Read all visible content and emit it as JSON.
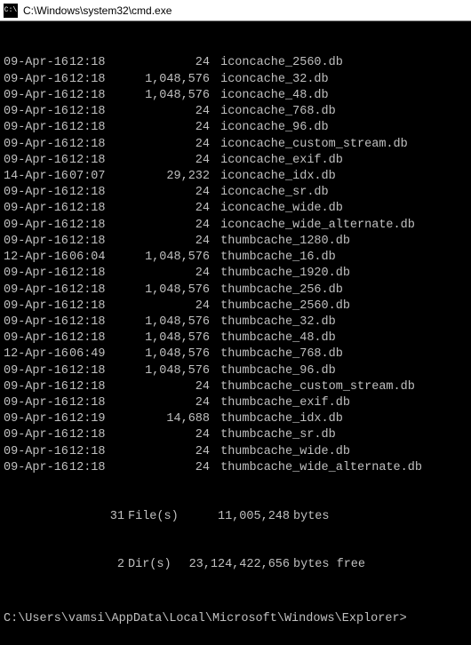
{
  "titlebar": {
    "icon_glyph": "C:\\",
    "path": "C:\\Windows\\system32\\cmd.exe"
  },
  "listing": [
    {
      "date": "09-Apr-16",
      "time": "12:18",
      "size": "24",
      "name": "iconcache_2560.db"
    },
    {
      "date": "09-Apr-16",
      "time": "12:18",
      "size": "1,048,576",
      "name": "iconcache_32.db"
    },
    {
      "date": "09-Apr-16",
      "time": "12:18",
      "size": "1,048,576",
      "name": "iconcache_48.db"
    },
    {
      "date": "09-Apr-16",
      "time": "12:18",
      "size": "24",
      "name": "iconcache_768.db"
    },
    {
      "date": "09-Apr-16",
      "time": "12:18",
      "size": "24",
      "name": "iconcache_96.db"
    },
    {
      "date": "09-Apr-16",
      "time": "12:18",
      "size": "24",
      "name": "iconcache_custom_stream.db"
    },
    {
      "date": "09-Apr-16",
      "time": "12:18",
      "size": "24",
      "name": "iconcache_exif.db"
    },
    {
      "date": "14-Apr-16",
      "time": "07:07",
      "size": "29,232",
      "name": "iconcache_idx.db"
    },
    {
      "date": "09-Apr-16",
      "time": "12:18",
      "size": "24",
      "name": "iconcache_sr.db"
    },
    {
      "date": "09-Apr-16",
      "time": "12:18",
      "size": "24",
      "name": "iconcache_wide.db"
    },
    {
      "date": "09-Apr-16",
      "time": "12:18",
      "size": "24",
      "name": "iconcache_wide_alternate.db"
    },
    {
      "date": "09-Apr-16",
      "time": "12:18",
      "size": "24",
      "name": "thumbcache_1280.db"
    },
    {
      "date": "12-Apr-16",
      "time": "06:04",
      "size": "1,048,576",
      "name": "thumbcache_16.db"
    },
    {
      "date": "09-Apr-16",
      "time": "12:18",
      "size": "24",
      "name": "thumbcache_1920.db"
    },
    {
      "date": "09-Apr-16",
      "time": "12:18",
      "size": "1,048,576",
      "name": "thumbcache_256.db"
    },
    {
      "date": "09-Apr-16",
      "time": "12:18",
      "size": "24",
      "name": "thumbcache_2560.db"
    },
    {
      "date": "09-Apr-16",
      "time": "12:18",
      "size": "1,048,576",
      "name": "thumbcache_32.db"
    },
    {
      "date": "09-Apr-16",
      "time": "12:18",
      "size": "1,048,576",
      "name": "thumbcache_48.db"
    },
    {
      "date": "12-Apr-16",
      "time": "06:49",
      "size": "1,048,576",
      "name": "thumbcache_768.db"
    },
    {
      "date": "09-Apr-16",
      "time": "12:18",
      "size": "1,048,576",
      "name": "thumbcache_96.db"
    },
    {
      "date": "09-Apr-16",
      "time": "12:18",
      "size": "24",
      "name": "thumbcache_custom_stream.db"
    },
    {
      "date": "09-Apr-16",
      "time": "12:18",
      "size": "24",
      "name": "thumbcache_exif.db"
    },
    {
      "date": "09-Apr-16",
      "time": "12:19",
      "size": "14,688",
      "name": "thumbcache_idx.db"
    },
    {
      "date": "09-Apr-16",
      "time": "12:18",
      "size": "24",
      "name": "thumbcache_sr.db"
    },
    {
      "date": "09-Apr-16",
      "time": "12:18",
      "size": "24",
      "name": "thumbcache_wide.db"
    },
    {
      "date": "09-Apr-16",
      "time": "12:18",
      "size": "24",
      "name": "thumbcache_wide_alternate.db"
    }
  ],
  "summary": {
    "files_count": "31",
    "files_label": "File(s)",
    "files_bytes": "11,005,248",
    "files_unit": "bytes",
    "dirs_count": "2",
    "dirs_label": "Dir(s)",
    "dirs_bytes": "23,124,422,656",
    "dirs_unit": "bytes free"
  },
  "prompt": "C:\\Users\\vamsi\\AppData\\Local\\Microsoft\\Windows\\Explorer>"
}
